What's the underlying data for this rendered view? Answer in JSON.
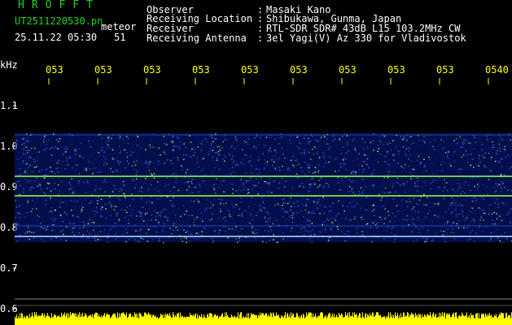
{
  "header": {
    "brand": "HROFFT",
    "filename": "UT2511220530.pn",
    "type_label": "meteor",
    "date_time": "25.11.22 05:30",
    "counter": "51",
    "info": [
      {
        "label": "Observer",
        "sep": ":",
        "value": "Masaki Kano"
      },
      {
        "label": "Receiving Location",
        "sep": ":",
        "value": "Shibukawa, Gunma, Japan"
      },
      {
        "label": "Receiver",
        "sep": ":",
        "value": "RTL-SDR SDR# 43dB L15 103.2MHz CW"
      },
      {
        "label": "Receiving Antenna",
        "sep": ":",
        "value": "3el Yagi(V) Az 330 for Vladivostok"
      }
    ]
  },
  "axis": {
    "unit": "kHz",
    "y_ticks": [
      "1.1",
      "1.0",
      "0.9",
      "0.8",
      "0.7",
      "0.6"
    ],
    "time_ticks": [
      "053",
      "053",
      "053",
      "053",
      "053",
      "053",
      "053",
      "053",
      "053",
      "0540"
    ]
  },
  "colors": {
    "background": "#000000",
    "label_green": "#1fd61f",
    "tick_yellow": "#ffff00",
    "spectrum_deep": "#0a1a8a",
    "spectrum_mid": "#2d6cff",
    "spectrum_hot": "#9cff6a",
    "signal_line": "#7dff4a",
    "amplitude_bar": "#ffff00"
  }
}
